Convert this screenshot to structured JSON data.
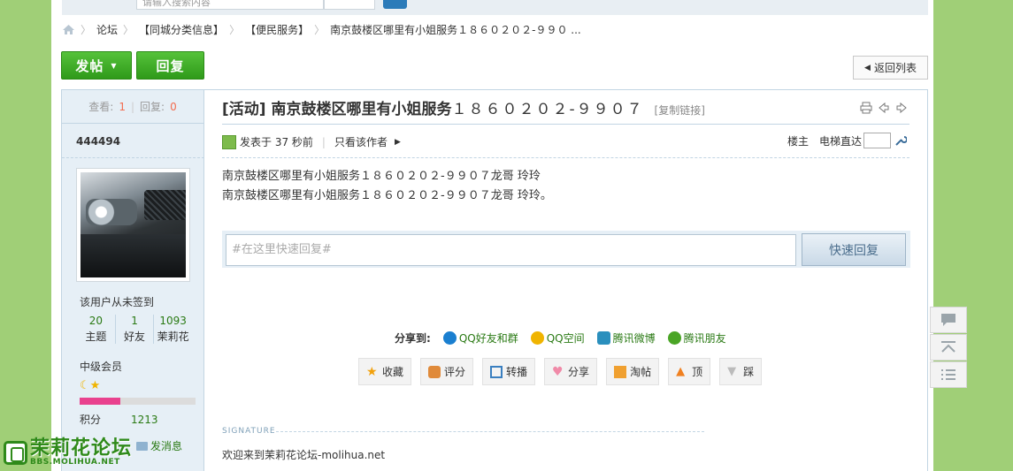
{
  "search": {
    "placeholder": "请输入搜索内容"
  },
  "breadcrumb": {
    "items": [
      "论坛",
      "【同城分类信息】",
      "【便民服务】",
      "南京鼓楼区哪里有小姐服务１８６０２０２-９９０ ..."
    ]
  },
  "toolbar": {
    "post_label": "发帖",
    "reply_label": "回复",
    "back_label": "返回列表"
  },
  "stats": {
    "views_label": "查看:",
    "views": "1",
    "replies_label": "回复:",
    "replies": "0"
  },
  "author": {
    "username": "444494",
    "signin": "该用户从未签到",
    "counts": [
      {
        "value": "20",
        "label": "主题"
      },
      {
        "value": "1",
        "label": "好友"
      },
      {
        "value": "1093",
        "label": "茉莉花"
      }
    ],
    "level": "中级会员",
    "level_progress": 0.35,
    "points_label": "积分",
    "points": "1213",
    "message_label": "发消息"
  },
  "post": {
    "tag": "[活动]",
    "title": "南京鼓楼区哪里有小姐服务",
    "title_number": "１８６０２０２-９９０７",
    "copy_link": "[复制链接]",
    "posted_at": "发表于 37 秒前",
    "author_only": "只看该作者",
    "floor_label": "楼主",
    "jump_label": "电梯直达",
    "content_lines": [
      "南京鼓楼区哪里有小姐服务１８６０２０２-９９０７龙哥 玲玲",
      "南京鼓楼区哪里有小姐服务１８６０２０２-９９０７龙哥 玲玲。"
    ]
  },
  "quick_reply": {
    "placeholder": "#在这里快速回复#",
    "button": "快速回复"
  },
  "share": {
    "label": "分享到:",
    "items": [
      {
        "label": "QQ好友和群",
        "icon": "qq-icon",
        "color": "#1a7fd0"
      },
      {
        "label": "QQ空间",
        "icon": "qzone-icon",
        "color": "#f0b400"
      },
      {
        "label": "腾讯微博",
        "icon": "tencent-weibo-icon",
        "color": "#2a8fbd"
      },
      {
        "label": "腾讯朋友",
        "icon": "tencent-friends-icon",
        "color": "#4aa526"
      }
    ]
  },
  "actions": [
    {
      "label": "收藏",
      "icon": "star-icon",
      "color": "#f2a10c"
    },
    {
      "label": "评分",
      "icon": "thumb-icon",
      "color": "#e08a3a"
    },
    {
      "label": "转播",
      "icon": "forward-icon",
      "color": "#3a7fc0"
    },
    {
      "label": "分享",
      "icon": "heart-icon",
      "color": "#f08aa8"
    },
    {
      "label": "淘帖",
      "icon": "box-icon",
      "color": "#f0a030"
    },
    {
      "label": "顶",
      "icon": "up-arrow-icon",
      "color": "#f08020"
    },
    {
      "label": "踩",
      "icon": "down-arrow-icon",
      "color": "#bbbbbb"
    }
  ],
  "signature": {
    "label": "SIGNATURE",
    "text": "欢迎来到茉莉花论坛-molihua.net"
  },
  "logo": {
    "name": "茉莉花论坛",
    "url": "BBS.MOLIHUA.NET"
  },
  "colors": {
    "accent_green": "#2f9a1a",
    "link_green": "#2a7a14",
    "border_blue": "#c2d5e3",
    "bg_green": "#a0cf77"
  }
}
